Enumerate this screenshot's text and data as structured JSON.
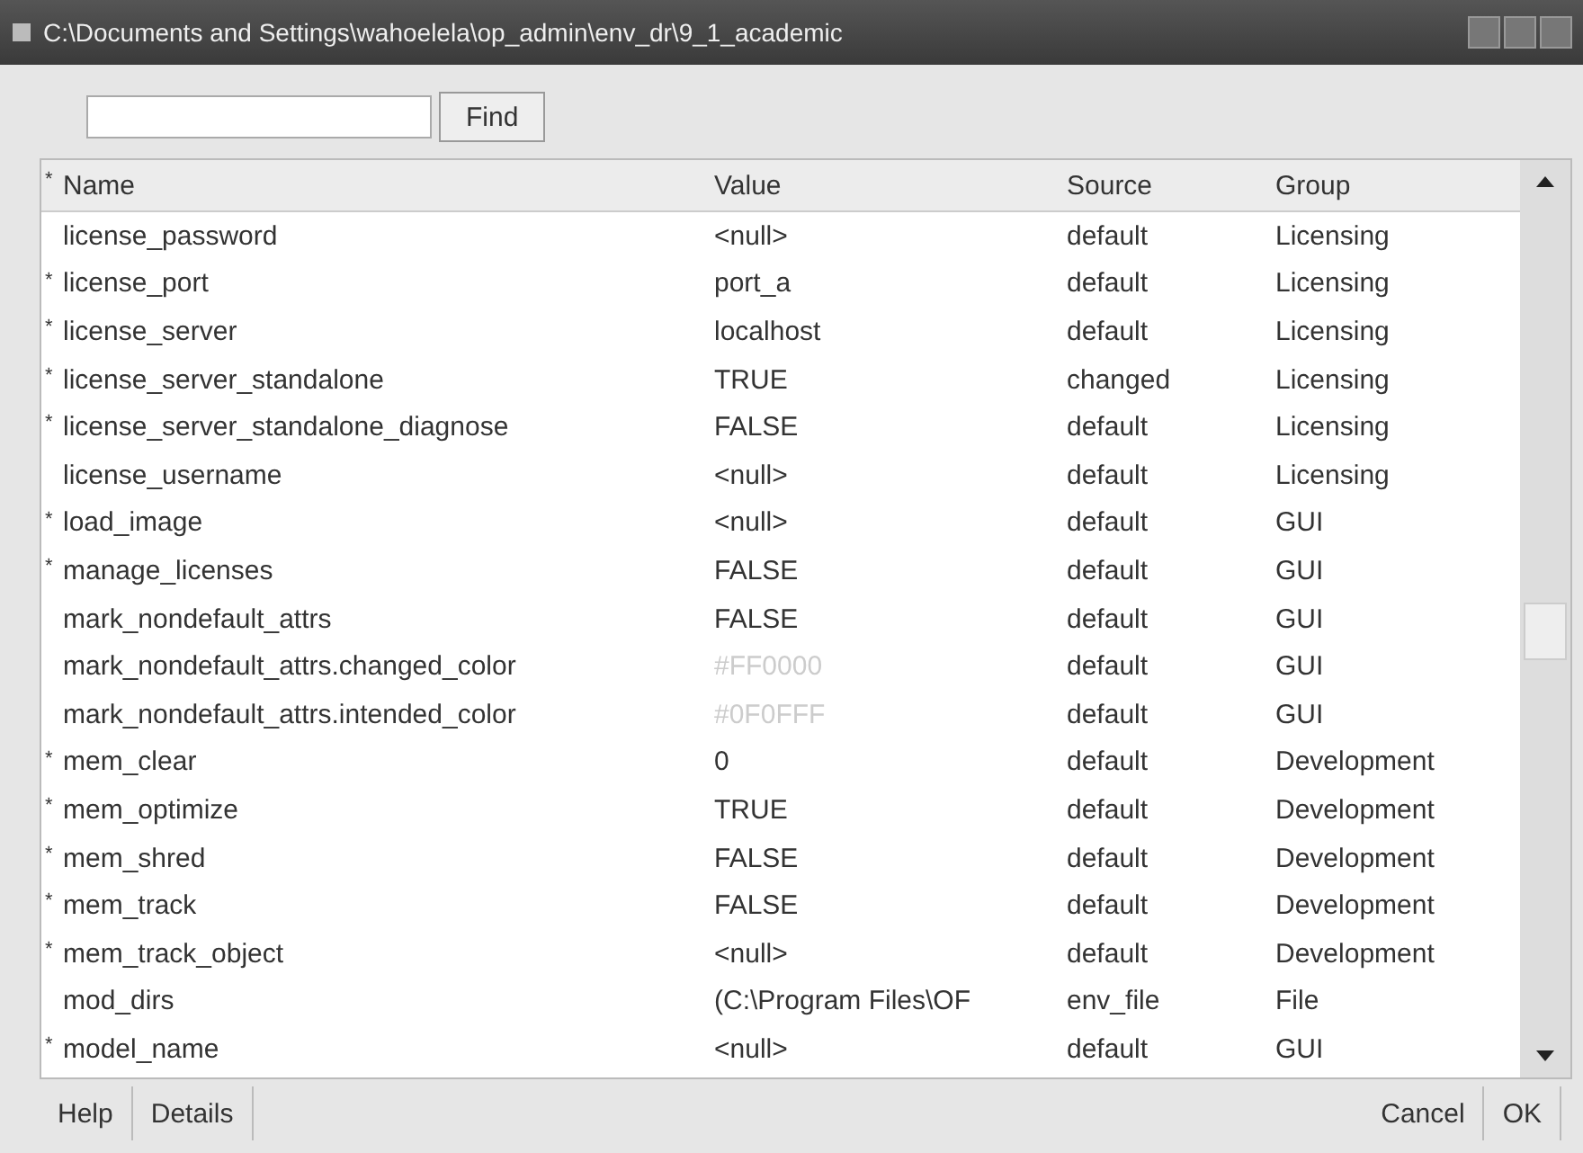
{
  "window": {
    "title": "C:\\Documents and Settings\\wahoelela\\op_admin\\env_dr\\9_1_academic"
  },
  "search": {
    "button": "Find"
  },
  "table": {
    "header_mark": "*",
    "columns": [
      "Name",
      "Value",
      "Source",
      "Group"
    ],
    "rows": [
      {
        "starred": false,
        "name": "license_password",
        "value": "<null>",
        "dimmed": false,
        "source": "default",
        "group": "Licensing"
      },
      {
        "starred": true,
        "name": "license_port",
        "value": "port_a",
        "dimmed": false,
        "source": "default",
        "group": "Licensing"
      },
      {
        "starred": true,
        "name": "license_server",
        "value": "localhost",
        "dimmed": false,
        "source": "default",
        "group": "Licensing"
      },
      {
        "starred": true,
        "name": "license_server_standalone",
        "value": "TRUE",
        "dimmed": false,
        "source": "changed",
        "group": "Licensing"
      },
      {
        "starred": true,
        "name": "license_server_standalone_diagnose",
        "value": "FALSE",
        "dimmed": false,
        "source": "default",
        "group": "Licensing"
      },
      {
        "starred": false,
        "name": "license_username",
        "value": "<null>",
        "dimmed": false,
        "source": "default",
        "group": "Licensing"
      },
      {
        "starred": true,
        "name": "load_image",
        "value": "<null>",
        "dimmed": false,
        "source": "default",
        "group": "GUI"
      },
      {
        "starred": true,
        "name": "manage_licenses",
        "value": "FALSE",
        "dimmed": false,
        "source": "default",
        "group": "GUI"
      },
      {
        "starred": false,
        "name": "mark_nondefault_attrs",
        "value": "FALSE",
        "dimmed": false,
        "source": "default",
        "group": "GUI"
      },
      {
        "starred": false,
        "name": "mark_nondefault_attrs.changed_color",
        "value": "#FF0000",
        "dimmed": true,
        "source": "default",
        "group": "GUI"
      },
      {
        "starred": false,
        "name": "mark_nondefault_attrs.intended_color",
        "value": "#0F0FFF",
        "dimmed": true,
        "source": "default",
        "group": "GUI"
      },
      {
        "starred": true,
        "name": "mem_clear",
        "value": "0",
        "dimmed": false,
        "source": "default",
        "group": "Development"
      },
      {
        "starred": true,
        "name": "mem_optimize",
        "value": "TRUE",
        "dimmed": false,
        "source": "default",
        "group": "Development"
      },
      {
        "starred": true,
        "name": "mem_shred",
        "value": "FALSE",
        "dimmed": false,
        "source": "default",
        "group": "Development"
      },
      {
        "starred": true,
        "name": "mem_track",
        "value": "FALSE",
        "dimmed": false,
        "source": "default",
        "group": "Development"
      },
      {
        "starred": true,
        "name": "mem_track_object",
        "value": "<null>",
        "dimmed": false,
        "source": "default",
        "group": "Development"
      },
      {
        "starred": false,
        "name": "mod_dirs",
        "value": "(C:\\Program Files\\OF",
        "dimmed": false,
        "source": "env_file",
        "group": "File"
      },
      {
        "starred": true,
        "name": "model_name",
        "value": "<null>",
        "dimmed": false,
        "source": "default",
        "group": "GUI"
      }
    ]
  },
  "footer": {
    "left": [
      "Help",
      "Details"
    ],
    "right": [
      "Cancel",
      "OK"
    ]
  }
}
